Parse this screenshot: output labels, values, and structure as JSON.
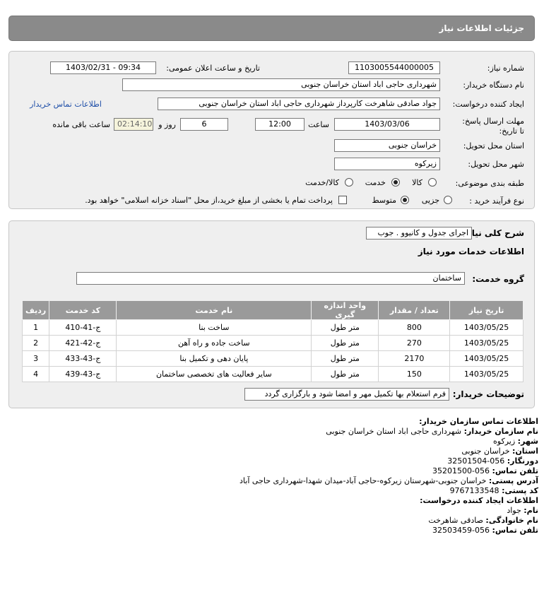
{
  "header": {
    "title": "جزئیات اطلاعات نیاز"
  },
  "form": {
    "need_number": {
      "label": "شماره نیاز:",
      "value": "1103005544000005"
    },
    "announce_datetime": {
      "label": "تاریخ و ساعت اعلان عمومی:",
      "value": "1403/02/31 - 09:34"
    },
    "buyer_org": {
      "label": "نام دستگاه خریدار:",
      "value": "شهرداری حاجی اباد استان خراسان جنوبی"
    },
    "requester": {
      "label": "ایجاد کننده درخواست:",
      "value": "جواد صادقی شاهرخت کارپرداز شهرداری حاجی اباد استان خراسان جنوبی"
    },
    "buyer_contact_link": "اطلاعات تماس خریدار",
    "deadline": {
      "label": "مهلت ارسال پاسخ: تا تاریخ:",
      "date": "1403/03/06",
      "time_label": "ساعت",
      "time": "12:00",
      "days": "6",
      "days_label": "روز و",
      "remaining": "02:14:10",
      "remaining_label": "ساعت باقی مانده"
    },
    "delivery_province": {
      "label": "استان محل تحویل:",
      "value": "خراسان جنوبی"
    },
    "delivery_city": {
      "label": "شهر محل تحویل:",
      "value": "زیرکوه"
    },
    "category": {
      "label": "طبقه بندی موضوعی:",
      "options": [
        "کالا",
        "خدمت",
        "کالا/خدمت"
      ],
      "selected": "خدمت"
    },
    "purchase_type": {
      "label": "نوع فرآیند خرید :",
      "options": [
        "جزیی",
        "متوسط"
      ],
      "selected": "متوسط",
      "payment_note": "پرداخت تمام یا بخشی از مبلغ خرید،از محل \"اسناد خزانه اسلامی\" خواهد بود."
    }
  },
  "need": {
    "summary_label": "شرح کلی نیاز:",
    "summary_value": "اجرای جدول و کانیوو . جوب",
    "services_title": "اطلاعات خدمات مورد نیاز",
    "service_group_label": "گروه خدمت:",
    "service_group_value": "ساختمان",
    "table": {
      "headers": [
        "ردیف",
        "کد خدمت",
        "نام خدمت",
        "واحد اندازه گیری",
        "تعداد / مقدار",
        "تاریخ نیاز"
      ],
      "rows": [
        [
          "1",
          "ج-41-410",
          "ساخت بنا",
          "متر طول",
          "800",
          "1403/05/25"
        ],
        [
          "2",
          "ج-42-421",
          "ساخت جاده و راه آهن",
          "متر طول",
          "270",
          "1403/05/25"
        ],
        [
          "3",
          "ج-43-433",
          "پایان دهی و تکمیل بنا",
          "متر طول",
          "2170",
          "1403/05/25"
        ],
        [
          "4",
          "ج-43-439",
          "سایر فعالیت های تخصصی ساختمان",
          "متر طول",
          "150",
          "1403/05/25"
        ]
      ]
    },
    "buyer_notes_label": "توضیحات خریدار:",
    "buyer_notes_value": "فرم استعلام بها تکمیل مهر و امضا شود و بارگزاری گردد"
  },
  "contact": {
    "title": "اطلاعات تماس سازمان خریدار:",
    "org_label": "نام سازمان خریدار:",
    "org_value": "شهرداری حاجی اباد استان خراسان جنوبی",
    "city_label": "شهر:",
    "city_value": "زیرکوه",
    "province_label": "استان:",
    "province_value": "خراسان جنوبی",
    "fax_label": "دورنگار:",
    "fax_value": "056-32501504",
    "phone_label": "تلفن تماس:",
    "phone_value": "056-35201500",
    "address_label": "آدرس پستی:",
    "address_value": "خراسان جنوبی-شهرستان زیرکوه-حاجی آباد-میدان شهدا-شهرداری حاجی آباد",
    "postal_label": "کد پستی:",
    "postal_value": "9767133548",
    "creator_title": "اطلاعات ایجاد کننده درخواست:",
    "name_label": "نام:",
    "name_value": "جواد",
    "family_label": "نام خانوادگی:",
    "family_value": "صادقی شاهرخت",
    "creator_phone_label": "تلفن تماس:",
    "creator_phone_value": "056-32503459"
  }
}
